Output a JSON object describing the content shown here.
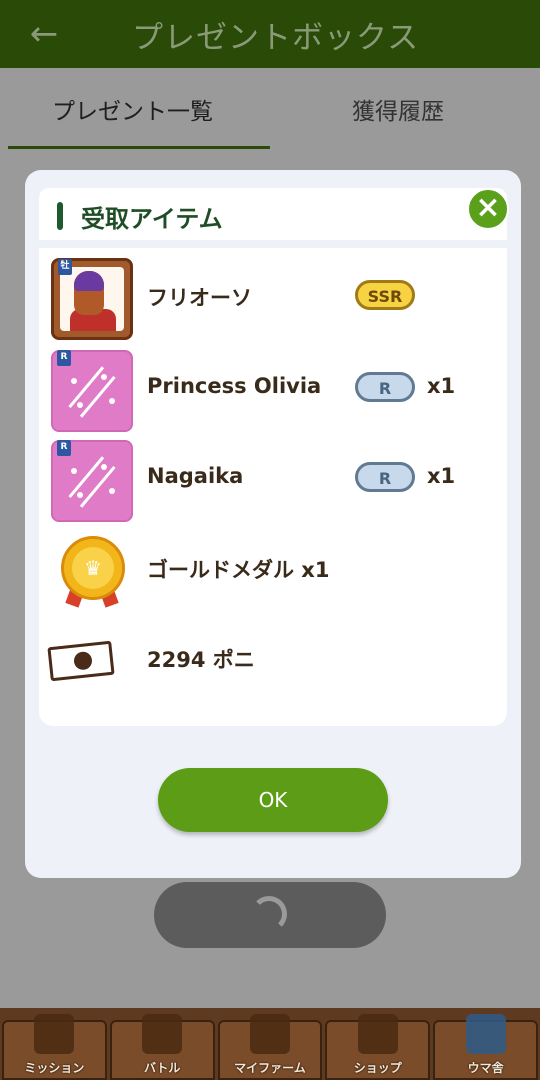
{
  "appbar": {
    "title": "プレゼントボックス",
    "back_icon": "arrow-left-icon"
  },
  "tabs": [
    {
      "label": "プレゼント一覧",
      "active": true
    },
    {
      "label": "獲得履歴",
      "active": false
    }
  ],
  "dialog": {
    "title": "受取アイテム",
    "close_icon": "close-icon",
    "items": [
      {
        "name": "フリオーソ",
        "rarity": "SSR",
        "quantity": "",
        "icon": "horse-card-icon"
      },
      {
        "name": "Princess Olivia",
        "rarity": "R",
        "quantity": "x1",
        "icon": "skill-icon"
      },
      {
        "name": "Nagaika",
        "rarity": "R",
        "quantity": "x1",
        "icon": "skill-icon"
      },
      {
        "name": "ゴールドメダル x1",
        "rarity": "",
        "quantity": "",
        "icon": "gold-medal-icon"
      },
      {
        "name": "2294 ポニ",
        "rarity": "",
        "quantity": "",
        "icon": "poni-ticket-icon"
      }
    ],
    "ok_label": "OK"
  },
  "bottom_nav": [
    {
      "label": "ミッション"
    },
    {
      "label": "バトル"
    },
    {
      "label": "マイファーム"
    },
    {
      "label": "ショップ"
    },
    {
      "label": "ウマ舎"
    }
  ],
  "colors": {
    "appbar": "#2a4a08",
    "accent_green": "#5c9c16",
    "title_green": "#1f4d26",
    "ssr_gold": "#f7d343",
    "r_blue": "#c7d9ea"
  }
}
